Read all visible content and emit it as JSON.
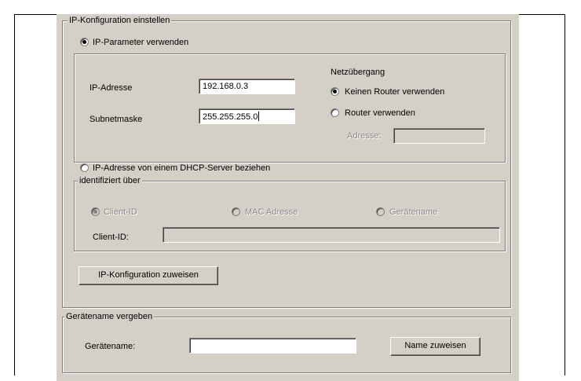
{
  "ip_config": {
    "group_title": "IP-Konfiguration einstellen",
    "use_ip_params_label": "IP-Parameter verwenden",
    "ip_address_label": "IP-Adresse",
    "ip_address_value": "192.168.0.3",
    "subnet_label": "Subnetmaske",
    "subnet_value": "255.255.255.0",
    "gateway_title": "Netzübergang",
    "no_router_label": "Keinen Router verwenden",
    "use_router_label": "Router verwenden",
    "router_address_label": "Adresse:",
    "router_address_value": "",
    "dhcp_label": "IP-Adresse von einem DHCP-Server beziehen",
    "identified_by_title": "identifiziert über",
    "client_id_option": "Client-ID",
    "mac_option": "MAC Adresse",
    "device_name_option": "Gerätename",
    "client_id_label": "Client-ID:",
    "client_id_value": "",
    "assign_button": "IP-Konfiguration zuweisen"
  },
  "device_name": {
    "group_title": "Gerätename vergeben",
    "label": "Gerätename:",
    "value": "",
    "assign_button": "Name zuweisen"
  }
}
